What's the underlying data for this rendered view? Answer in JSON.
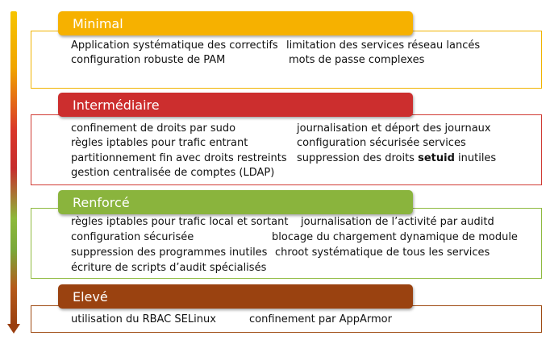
{
  "levels": [
    {
      "name": "Minimal",
      "color": "#f6b100",
      "items": [
        "Application systématique des correctifs",
        "limitation des services réseau lancés",
        "configuration robuste de PAM",
        "mots de passe complexes"
      ]
    },
    {
      "name": "Intermédiaire",
      "color": "#cc2e2e",
      "items": [
        "confinement de droits par sudo",
        "journalisation et déport des journaux",
        "règles iptables pour trafic entrant",
        "configuration sécurisée services",
        "partitionnement fin avec droits restreints",
        "suppression des droits ",
        "setuid",
        " inutiles",
        "gestion centralisée de comptes (LDAP)"
      ]
    },
    {
      "name": "Renforcé",
      "color": "#8ab43d",
      "items": [
        "règles iptables pour trafic local et sortant",
        "journalisation de l’activité par auditd",
        "configuration sécurisée",
        "blocage du chargement dynamique de module",
        "suppression des programmes inutiles",
        "chroot systématique de tous les services",
        "écriture de scripts d’audit spécialisés"
      ]
    },
    {
      "name": "Elevé",
      "color": "#9a4210",
      "items": [
        "utilisation du RBAC SELinux",
        "confinement par AppArmor"
      ]
    }
  ]
}
